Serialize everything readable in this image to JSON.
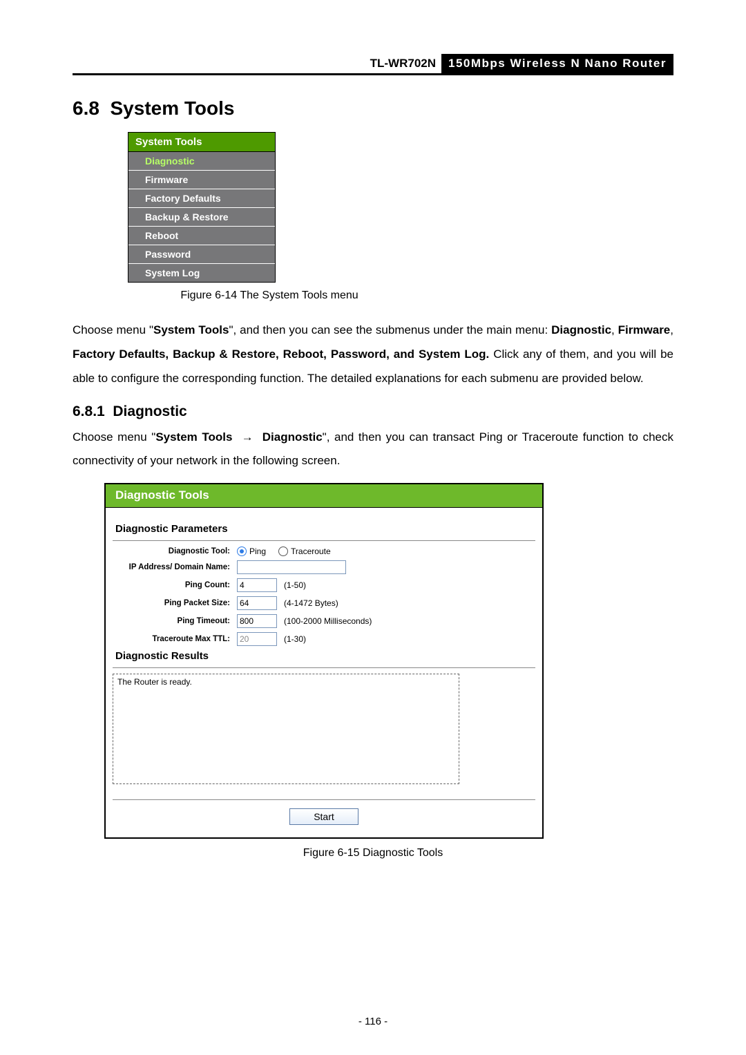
{
  "header": {
    "model": "TL-WR702N",
    "desc": "150Mbps Wireless N Nano Router"
  },
  "section": {
    "number": "6.8",
    "title": "System Tools"
  },
  "menu": {
    "title": "System Tools",
    "items": [
      {
        "label": "Diagnostic",
        "active": true
      },
      {
        "label": "Firmware",
        "active": false
      },
      {
        "label": "Factory Defaults",
        "active": false
      },
      {
        "label": "Backup & Restore",
        "active": false
      },
      {
        "label": "Reboot",
        "active": false
      },
      {
        "label": "Password",
        "active": false
      },
      {
        "label": "System Log",
        "active": false
      }
    ]
  },
  "fig14": "Figure 6-14 The System Tools menu",
  "para1_a": "Choose menu \"",
  "para1_b": "System Tools",
  "para1_c": "\", and then you can see the submenus under the main menu: ",
  "para1_d": "Diagnostic",
  "para1_e": ", ",
  "para1_f": "Firmware",
  "para1_g": ", ",
  "para1_h": "Factory Defaults, Backup & Restore, Reboot, Password, and System Log.",
  "para1_i": " Click any of them, and you will be able to configure the corresponding function. The detailed explanations for each submenu are provided below.",
  "subsection": {
    "number": "6.8.1",
    "title": "Diagnostic"
  },
  "para2_a": "Choose menu \"",
  "para2_b": "System Tools",
  "arrow": "→",
  "para2_c": "Diagnostic",
  "para2_d": "\", and then you can transact Ping or Traceroute function to check connectivity of your network in the following screen.",
  "diag": {
    "title": "Diagnostic Tools",
    "section_params": "Diagnostic Parameters",
    "labels": {
      "tool": "Diagnostic Tool:",
      "ip": "IP Address/ Domain Name:",
      "count": "Ping Count:",
      "size": "Ping Packet Size:",
      "timeout": "Ping Timeout:",
      "ttl": "Traceroute Max TTL:"
    },
    "radio_ping": "Ping",
    "radio_trace": "Traceroute",
    "values": {
      "ip": "",
      "count": "4",
      "size": "64",
      "timeout": "800",
      "ttl": "20"
    },
    "hints": {
      "count": "(1-50)",
      "size": "(4-1472 Bytes)",
      "timeout": "(100-2000 Milliseconds)",
      "ttl": "(1-30)"
    },
    "section_results": "Diagnostic Results",
    "result_text": "The Router is ready.",
    "start": "Start"
  },
  "fig15": "Figure 6-15    Diagnostic Tools",
  "page_number": "- 116 -"
}
